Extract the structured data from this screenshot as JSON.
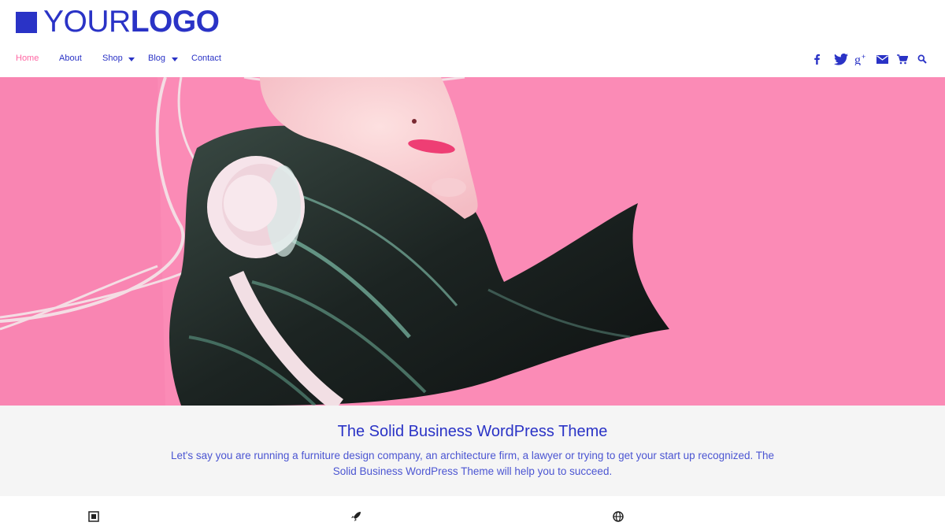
{
  "brand": {
    "logo_light": "YOUR",
    "logo_bold": "LOGO",
    "color": "#2a33c6"
  },
  "nav": {
    "items": [
      {
        "label": "Home",
        "active": true
      },
      {
        "label": "About",
        "active": false
      },
      {
        "label": "Shop",
        "active": false,
        "dropdown": true
      },
      {
        "label": "Blog",
        "active": false,
        "dropdown": true
      },
      {
        "label": "Contact",
        "active": false
      }
    ],
    "active_color": "#ff66a3"
  },
  "social_icons": [
    "facebook-icon",
    "twitter-icon",
    "google-plus-icon",
    "email-icon",
    "cart-icon",
    "search-icon"
  ],
  "hero": {
    "image": "woman-with-headphones-pink-background",
    "background": "#fb8bb6"
  },
  "intro": {
    "title": "The Solid Business WordPress Theme",
    "text": "Let's say you are running a furniture design company, an architecture firm, a lawyer or trying to get your start up recognized. The Solid Business WordPress Theme will help you to succeed."
  },
  "feature_icons": [
    "square-icon",
    "rocket-icon",
    "globe-icon"
  ]
}
